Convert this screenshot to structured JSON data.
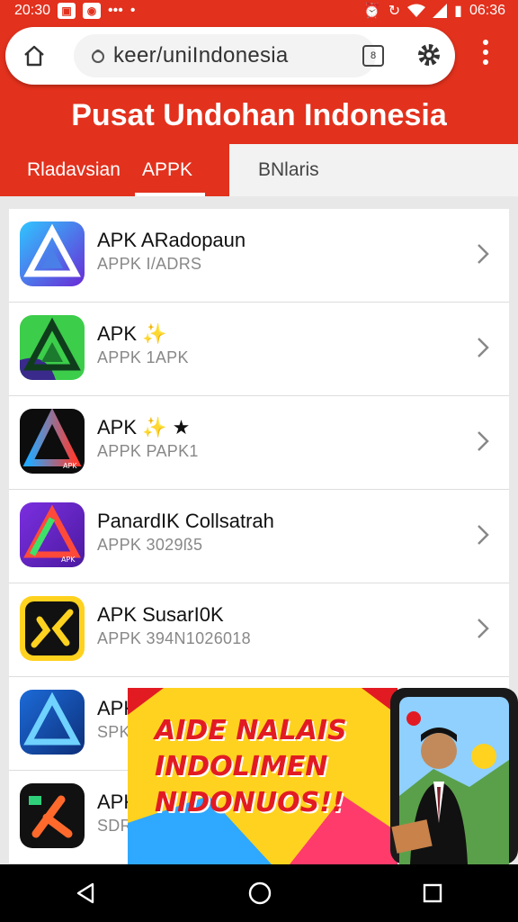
{
  "status_bar": {
    "time_left": "20:30",
    "time_right": "06:36",
    "dots": "•••"
  },
  "browser": {
    "url": "keer/uniIndonesia",
    "tab_count": "8"
  },
  "page": {
    "title": "Pusat Undohan Indonesia"
  },
  "tabs": [
    {
      "label": "Rladavsian",
      "active": false
    },
    {
      "label": "APPK",
      "active": true
    },
    {
      "label": "BNlaris",
      "active": false
    }
  ],
  "apps": [
    {
      "title": "APK ARadopaun",
      "subtitle": "APPK I/ADRS",
      "icon": "apk-prism-blue-icon"
    },
    {
      "title": "APK ✨",
      "subtitle": "APPK 1APK",
      "icon": "apk-prism-green-icon"
    },
    {
      "title": "APK ✨ ★",
      "subtitle": "APPK PAPK1",
      "icon": "apk-prism-black-icon"
    },
    {
      "title": "PanardIK Collsatrah",
      "subtitle": "APPK 3029ß5",
      "icon": "apk-prism-purple-icon"
    },
    {
      "title": "APK SusarI0K",
      "subtitle": "APPK 394N1026018",
      "icon": "apk-x-yellow-icon"
    },
    {
      "title": "APK",
      "subtitle": "SPK",
      "icon": "apk-prism-darkblue-icon"
    },
    {
      "title": "APK",
      "subtitle": "SDR",
      "icon": "apk-k-black-icon"
    }
  ],
  "banner": {
    "lines": [
      "AIDE NALAIS",
      "INDOLIMEN",
      "NIDONUOS!!"
    ]
  },
  "colors": {
    "brand_red": "#e2311d",
    "banner_yellow": "#ffd21f",
    "banner_text": "#e21b23"
  }
}
